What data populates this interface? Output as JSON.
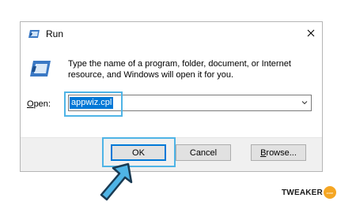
{
  "window": {
    "title": "Run",
    "close_label": "close"
  },
  "body": {
    "description": "Type the name of a program, folder, document, or Internet resource, and Windows will open it for you."
  },
  "open_field": {
    "label_underlined": "O",
    "label_rest": "pen:",
    "value": "appwiz.cpl"
  },
  "buttons": {
    "ok": "OK",
    "cancel": "Cancel",
    "browse_underlined": "B",
    "browse_rest": "rowse..."
  },
  "branding": {
    "text": "TWEAKER",
    "badge": "zone"
  },
  "colors": {
    "selection": "#0078d7",
    "highlight": "#4fb4e6",
    "cursor": "#4fb4e6",
    "brand": "#f5a623"
  }
}
